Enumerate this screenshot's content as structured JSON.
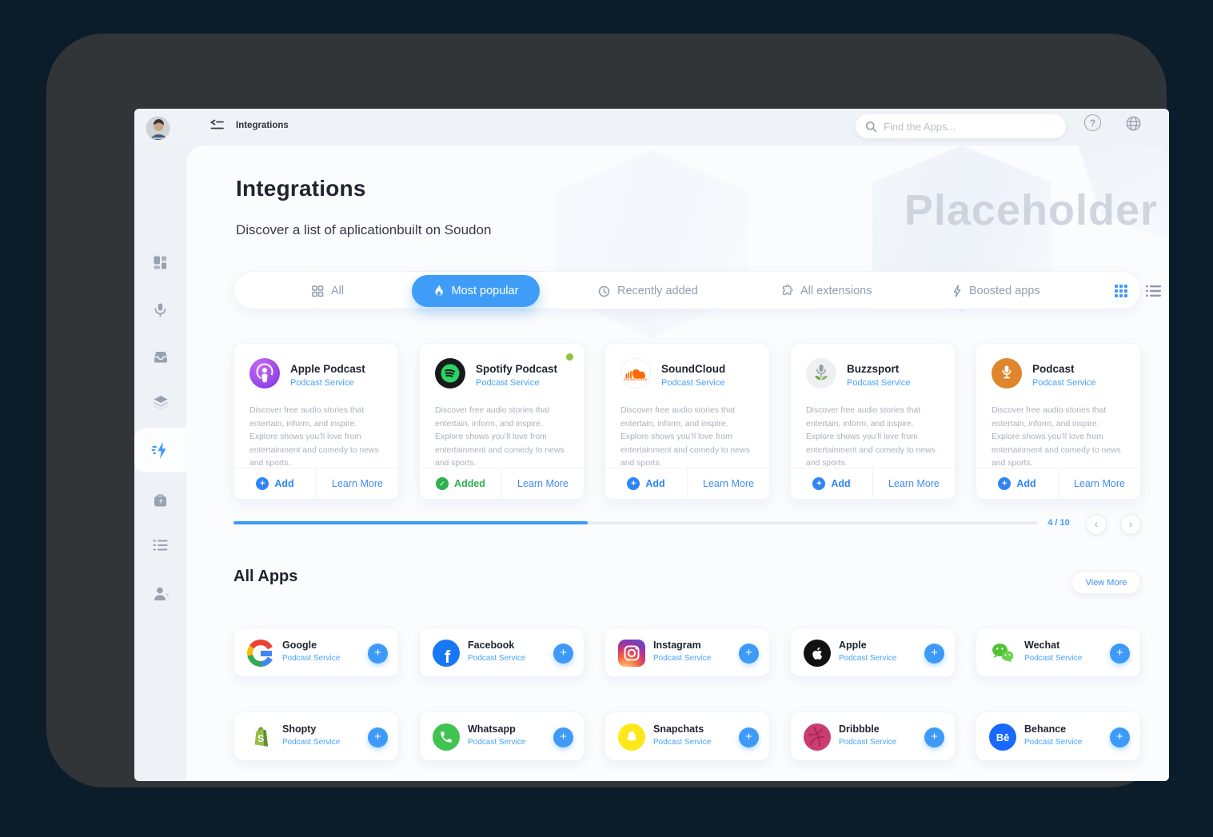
{
  "header": {
    "breadcrumb": "Integrations",
    "search_placeholder": "Find the Apps...",
    "icons": [
      "collapse-sidebar-icon",
      "search-icon",
      "help-icon",
      "globe-icon"
    ]
  },
  "sidebar": {
    "items": [
      {
        "icon": "dashboard-icon",
        "active": false
      },
      {
        "icon": "microphone-icon",
        "active": false
      },
      {
        "icon": "inbox-icon",
        "active": false
      },
      {
        "icon": "layers-icon",
        "active": false
      },
      {
        "icon": "flash-icon",
        "active": true
      },
      {
        "icon": "toolbox-icon",
        "active": false
      },
      {
        "icon": "playlist-icon",
        "active": false
      },
      {
        "icon": "account-icon",
        "active": false
      }
    ],
    "bottom_logo": "brand-logo"
  },
  "page": {
    "title": "Integrations",
    "subtitle": "Discover a list of aplicationbuilt on Soudon",
    "watermark": "Placeholder"
  },
  "tabs": {
    "items": [
      {
        "label": "All",
        "icon": "grid-icon",
        "active": false
      },
      {
        "label": "Most popular",
        "icon": "flame-icon",
        "active": true
      },
      {
        "label": "Recently added",
        "icon": "clock-icon",
        "active": false
      },
      {
        "label": "All extensions",
        "icon": "puzzle-icon",
        "active": false
      },
      {
        "label": "Boosted apps",
        "icon": "bolt-icon",
        "active": false
      }
    ],
    "view_modes": [
      {
        "icon": "grid-view-icon",
        "active": true
      },
      {
        "icon": "list-view-icon",
        "active": false
      }
    ]
  },
  "featured_cards": [
    {
      "name": "Apple Podcast",
      "category": "Podcast Service",
      "description": "Discover free audio stories that entertain, inform, and inspire. Explore shows you’ll love from entertainment and comedy to news and sports.",
      "action": "Add",
      "secondary": "Learn More",
      "installed": false
    },
    {
      "name": "Spotify Podcast",
      "category": "Podcast Service",
      "description": "Discover free audio stories that entertain, inform, and inspire. Explore shows you’ll love from entertainment and comedy to news and sports.",
      "action": "Added",
      "secondary": "Learn More",
      "installed": true
    },
    {
      "name": "SoundCloud",
      "category": "Podcast Service",
      "description": "Discover free audio stories that entertain, inform, and inspire. Explore shows you’ll love from entertainment and comedy to news and sports.",
      "action": "Add",
      "secondary": "Learn More",
      "installed": false
    },
    {
      "name": "Buzzsport",
      "category": "Podcast Service",
      "description": "Discover free audio stories that entertain, inform, and inspire. Explore shows you’ll love from entertainment and comedy to news and sports.",
      "action": "Add",
      "secondary": "Learn More",
      "installed": false
    },
    {
      "name": "Podcast",
      "category": "Podcast Service",
      "description": "Discover free audio stories that entertain, inform, and inspire. Explore shows you’ll love from entertainment and comedy to news and sports.",
      "action": "Add",
      "secondary": "Learn More",
      "installed": false
    }
  ],
  "pagination": {
    "label": "4 / 10",
    "progress_percent": 44
  },
  "all_apps": {
    "title": "All Apps",
    "view_more": "View More",
    "apps": [
      {
        "name": "Google",
        "category": "Podcast Service",
        "logo": "google-logo"
      },
      {
        "name": "Facebook",
        "category": "Podcast Service",
        "logo": "facebook-logo"
      },
      {
        "name": "Instagram",
        "category": "Podcast Service",
        "logo": "instagram-logo"
      },
      {
        "name": "Apple",
        "category": "Podcast Service",
        "logo": "apple-logo"
      },
      {
        "name": "Wechat",
        "category": "Podcast Service",
        "logo": "wechat-logo"
      },
      {
        "name": "Shopty",
        "category": "Podcast Service",
        "logo": "shopty-logo"
      },
      {
        "name": "Whatsapp",
        "category": "Podcast Service",
        "logo": "whatsapp-logo"
      },
      {
        "name": "Snapchats",
        "category": "Podcast Service",
        "logo": "snapchats-logo"
      },
      {
        "name": "Dribbble",
        "category": "Podcast Service",
        "logo": "dribbble-logo"
      },
      {
        "name": "Behance",
        "category": "Podcast Service",
        "logo": "behance-logo"
      }
    ]
  },
  "glyphs": {
    "plus": "+",
    "check": "✓",
    "help": "?",
    "prev": "‹",
    "next": "›"
  },
  "logo_texts": {
    "facebook": "f",
    "behance": "Bē",
    "shopty": "S"
  },
  "colors": {
    "accent": "#3f9df8",
    "added_green": "#2fae4e",
    "status_dot": "#8cc63f",
    "category_blue": "#46a3f8"
  }
}
